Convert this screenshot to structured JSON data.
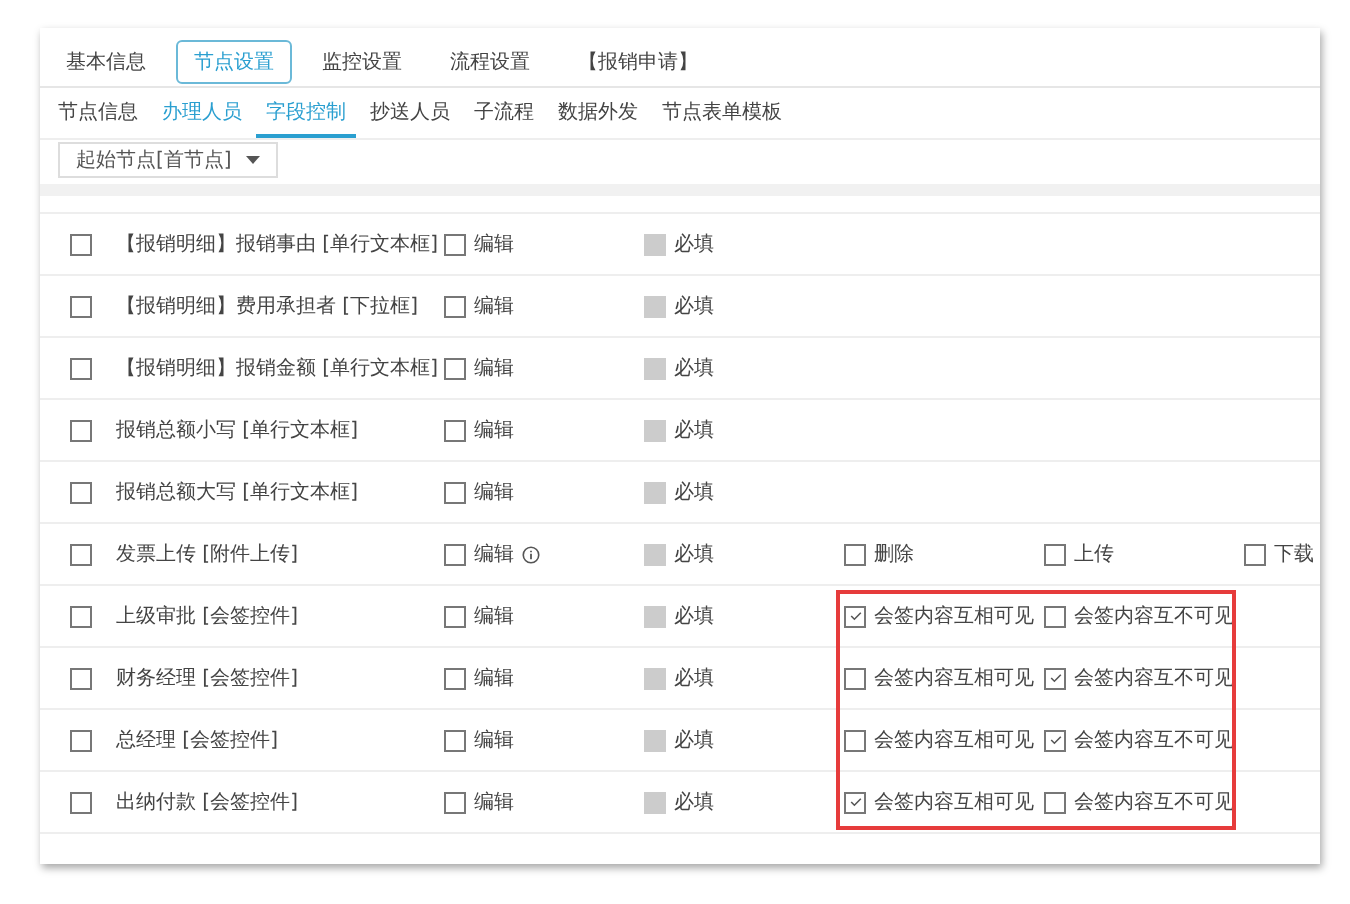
{
  "top_tabs": [
    {
      "label": "基本信息",
      "selected": false
    },
    {
      "label": "节点设置",
      "selected": true
    },
    {
      "label": "监控设置",
      "selected": false
    },
    {
      "label": "流程设置",
      "selected": false
    },
    {
      "label": "【报销申请】",
      "selected": false
    }
  ],
  "sub_tabs": [
    {
      "label": "节点信息",
      "selected": false,
      "accent": false
    },
    {
      "label": "办理人员",
      "selected": false,
      "accent": true
    },
    {
      "label": "字段控制",
      "selected": true,
      "accent": true
    },
    {
      "label": "抄送人员",
      "selected": false,
      "accent": false
    },
    {
      "label": "子流程",
      "selected": false,
      "accent": false
    },
    {
      "label": "数据外发",
      "selected": false,
      "accent": false
    },
    {
      "label": "节点表单模板",
      "selected": false,
      "accent": false
    }
  ],
  "node_select": {
    "value": "起始节点[首节点]"
  },
  "rows": [
    {
      "checked": false,
      "name": "【报销明细】报销事由 [单行文本框]",
      "edit": {
        "label": "编辑",
        "checked": false
      },
      "info": false,
      "required": {
        "label": "必填",
        "checked": false
      },
      "highlight": false,
      "options": []
    },
    {
      "checked": false,
      "name": "【报销明细】费用承担者 [下拉框]",
      "edit": {
        "label": "编辑",
        "checked": false
      },
      "info": false,
      "required": {
        "label": "必填",
        "checked": false
      },
      "highlight": false,
      "options": []
    },
    {
      "checked": false,
      "name": "【报销明细】报销金额 [单行文本框]",
      "edit": {
        "label": "编辑",
        "checked": false
      },
      "info": false,
      "required": {
        "label": "必填",
        "checked": false
      },
      "highlight": false,
      "options": []
    },
    {
      "checked": false,
      "name": "报销总额小写 [单行文本框]",
      "edit": {
        "label": "编辑",
        "checked": false
      },
      "info": false,
      "required": {
        "label": "必填",
        "checked": false
      },
      "highlight": false,
      "options": []
    },
    {
      "checked": false,
      "name": "报销总额大写 [单行文本框]",
      "edit": {
        "label": "编辑",
        "checked": false
      },
      "info": false,
      "required": {
        "label": "必填",
        "checked": false
      },
      "highlight": false,
      "options": []
    },
    {
      "checked": false,
      "name": "发票上传 [附件上传]",
      "edit": {
        "label": "编辑",
        "checked": false
      },
      "info": true,
      "required": {
        "label": "必填",
        "checked": false
      },
      "highlight": false,
      "options": [
        {
          "label": "删除",
          "checked": false
        },
        {
          "label": "上传",
          "checked": false
        },
        {
          "label": "下载",
          "checked": false
        }
      ]
    },
    {
      "checked": false,
      "name": "上级审批 [会签控件]",
      "edit": {
        "label": "编辑",
        "checked": false
      },
      "info": false,
      "required": {
        "label": "必填",
        "checked": false
      },
      "highlight": true,
      "options": [
        {
          "label": "会签内容互相可见",
          "checked": true
        },
        {
          "label": "会签内容互不可见",
          "checked": false
        }
      ]
    },
    {
      "checked": false,
      "name": "财务经理 [会签控件]",
      "edit": {
        "label": "编辑",
        "checked": false
      },
      "info": false,
      "required": {
        "label": "必填",
        "checked": false
      },
      "highlight": true,
      "options": [
        {
          "label": "会签内容互相可见",
          "checked": false
        },
        {
          "label": "会签内容互不可见",
          "checked": true
        }
      ]
    },
    {
      "checked": false,
      "name": "总经理 [会签控件]",
      "edit": {
        "label": "编辑",
        "checked": false
      },
      "info": false,
      "required": {
        "label": "必填",
        "checked": false
      },
      "highlight": true,
      "options": [
        {
          "label": "会签内容互相可见",
          "checked": false
        },
        {
          "label": "会签内容互不可见",
          "checked": true
        }
      ]
    },
    {
      "checked": false,
      "name": "出纳付款 [会签控件]",
      "edit": {
        "label": "编辑",
        "checked": false
      },
      "info": false,
      "required": {
        "label": "必填",
        "checked": false
      },
      "highlight": true,
      "options": [
        {
          "label": "会签内容互相可见",
          "checked": true
        },
        {
          "label": "会签内容互不可见",
          "checked": false
        }
      ]
    }
  ]
}
